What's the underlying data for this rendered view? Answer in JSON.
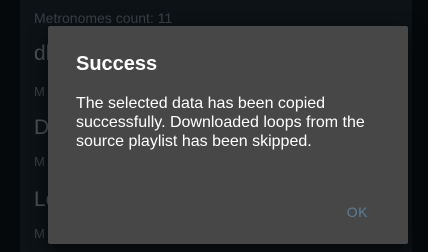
{
  "background": {
    "header": "Metronomes count: 11",
    "items": [
      {
        "title": "dl",
        "subtitle": "M"
      },
      {
        "title": "D",
        "subtitle": "M"
      },
      {
        "title": "Lo",
        "subtitle": "M"
      }
    ]
  },
  "dialog": {
    "title": "Success",
    "message": "The selected data has been copied successfully. Downloaded loops from the source playlist has been skipped.",
    "ok_label": "OK"
  }
}
